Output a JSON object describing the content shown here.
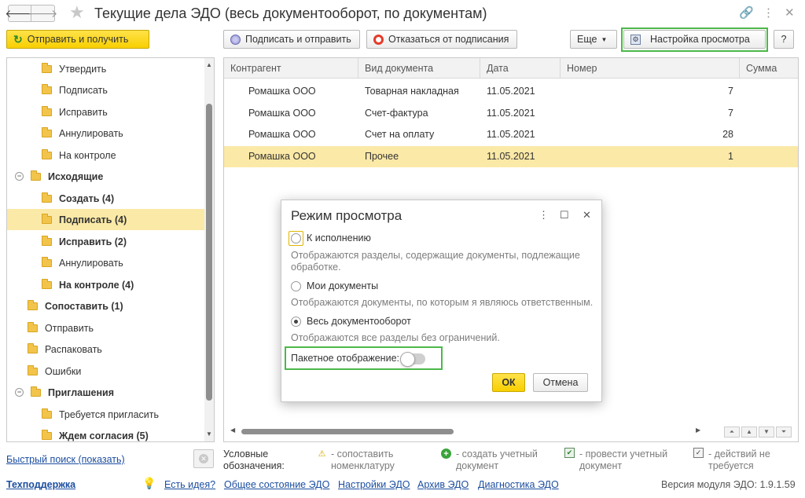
{
  "window": {
    "title": "Текущие дела ЭДО (весь документооборот, по документам)"
  },
  "toolbar": {
    "send_receive": "Отправить и получить",
    "sign_send": "Подписать и отправить",
    "refuse_sign": "Отказаться от подписания",
    "more": "Еще",
    "view_settings": "Настройка просмотра",
    "help": "?"
  },
  "tree": {
    "items": [
      {
        "label": "Утвердить"
      },
      {
        "label": "Подписать"
      },
      {
        "label": "Исправить"
      },
      {
        "label": "Аннулировать"
      },
      {
        "label": "На контроле"
      },
      {
        "label": "Исходящие"
      },
      {
        "label": "Создать (4)"
      },
      {
        "label": "Подписать (4)"
      },
      {
        "label": "Исправить (2)"
      },
      {
        "label": "Аннулировать"
      },
      {
        "label": "На контроле (4)"
      },
      {
        "label": "Сопоставить (1)"
      },
      {
        "label": "Отправить"
      },
      {
        "label": "Распаковать"
      },
      {
        "label": "Ошибки"
      },
      {
        "label": "Приглашения"
      },
      {
        "label": "Требуется пригласить"
      },
      {
        "label": "Ждем согласия (5)"
      }
    ]
  },
  "grid": {
    "columns": [
      "Контрагент",
      "Вид документа",
      "Дата",
      "Номер",
      "Сумма"
    ],
    "rows": [
      {
        "counterparty": "Ромашка ООО",
        "doc_type": "Товарная накладная",
        "date": "11.05.2021",
        "number": "7",
        "sum": ""
      },
      {
        "counterparty": "Ромашка ООО",
        "doc_type": "Счет-фактура",
        "date": "11.05.2021",
        "number": "7",
        "sum": ""
      },
      {
        "counterparty": "Ромашка ООО",
        "doc_type": "Счет на оплату",
        "date": "11.05.2021",
        "number": "28",
        "sum": ""
      },
      {
        "counterparty": "Ромашка ООО",
        "doc_type": "Прочее",
        "date": "11.05.2021",
        "number": "1",
        "sum": ""
      }
    ]
  },
  "modal": {
    "title": "Режим просмотра",
    "options": [
      {
        "label": "К исполнению",
        "hint1": "Отображаются разделы, содержащие документы, подлежащие",
        "hint2": "обработке.",
        "checked": false
      },
      {
        "label": "Мои документы",
        "hint1": "Отображаются документы, по которым я являюсь ответственным.",
        "hint2": "",
        "checked": false
      },
      {
        "label": "Весь документооборот",
        "hint1": "Отображаются все разделы без ограничений.",
        "hint2": "",
        "checked": true
      }
    ],
    "batch_label": "Пакетное отображение:",
    "batch_enabled": false,
    "ok": "ОК",
    "cancel": "Отмена"
  },
  "bottom": {
    "quick_search": "Быстрый поиск (показать)",
    "legend_title1": "Условные",
    "legend_title2": "обозначения:",
    "legend": [
      {
        "line1": "- сопоставить",
        "line2": "номенклатуру"
      },
      {
        "line1": "- создать учетный",
        "line2": "документ"
      },
      {
        "line1": "- провести учетный",
        "line2": "документ"
      },
      {
        "line1": "- действий не",
        "line2": "требуется"
      }
    ],
    "links": {
      "support": "Техподдержка",
      "idea": "Есть идея?",
      "status": "Общее состояние ЭДО",
      "settings": "Настройки ЭДО",
      "archive": "Архив ЭДО",
      "diagnostics": "Диагностика ЭДО"
    },
    "version": "Версия модуля ЭДО: 1.9.1.59"
  }
}
